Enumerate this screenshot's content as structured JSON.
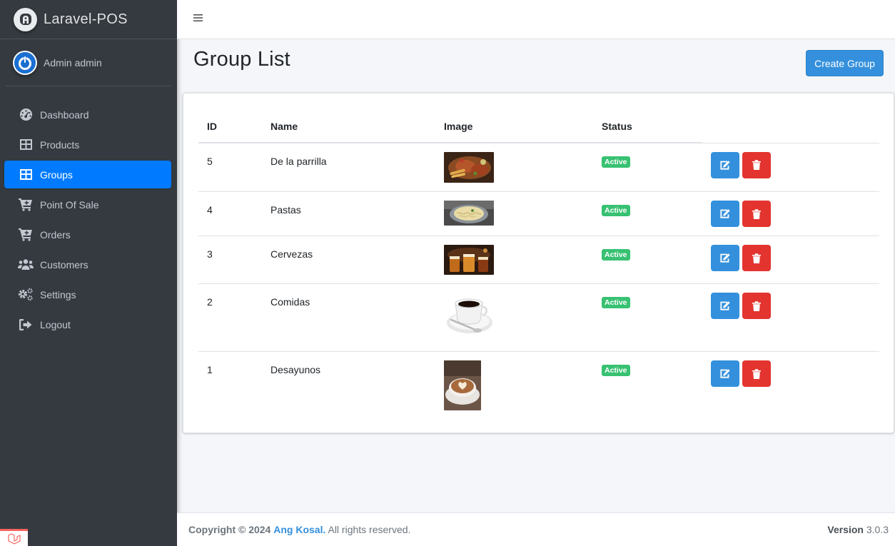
{
  "brand": {
    "name": "Laravel-POS"
  },
  "user": {
    "name": "Admin admin"
  },
  "sidebar": {
    "items": [
      {
        "label": "Dashboard",
        "icon": "dashboard-icon",
        "active": false
      },
      {
        "label": "Products",
        "icon": "table-icon",
        "active": false
      },
      {
        "label": "Groups",
        "icon": "table-icon",
        "active": true
      },
      {
        "label": "Point Of Sale",
        "icon": "cart-plus-icon",
        "active": false
      },
      {
        "label": "Orders",
        "icon": "cart-plus-icon",
        "active": false
      },
      {
        "label": "Customers",
        "icon": "users-icon",
        "active": false
      },
      {
        "label": "Settings",
        "icon": "cogs-icon",
        "active": false
      },
      {
        "label": "Logout",
        "icon": "sign-out-icon",
        "active": false
      }
    ]
  },
  "page": {
    "title": "Group List",
    "create_label": "Create Group"
  },
  "table": {
    "headers": {
      "id": "ID",
      "name": "Name",
      "image": "Image",
      "status": "Status"
    },
    "rows": [
      {
        "id": "5",
        "name": "De la parrilla",
        "image": "grilled-food-photo",
        "status": "Active"
      },
      {
        "id": "4",
        "name": "Pastas",
        "image": "pasta-bowl-photo",
        "status": "Active"
      },
      {
        "id": "3",
        "name": "Cervezas",
        "image": "beer-glasses-photo",
        "status": "Active"
      },
      {
        "id": "2",
        "name": "Comidas",
        "image": "coffee-cup-photo",
        "status": "Active"
      },
      {
        "id": "1",
        "name": "Desayunos",
        "image": "latte-art-photo",
        "status": "Active"
      }
    ]
  },
  "footer": {
    "copyright_prefix": "Copyright © 2024",
    "author": "Ang Kosal.",
    "rights": "All rights reserved.",
    "version_label": "Version",
    "version": "3.0.3"
  },
  "colors": {
    "sidebar_bg": "#343a40",
    "active_nav": "#007bff",
    "primary": "#3490dc",
    "danger": "#e3342f",
    "success": "#38c172"
  }
}
